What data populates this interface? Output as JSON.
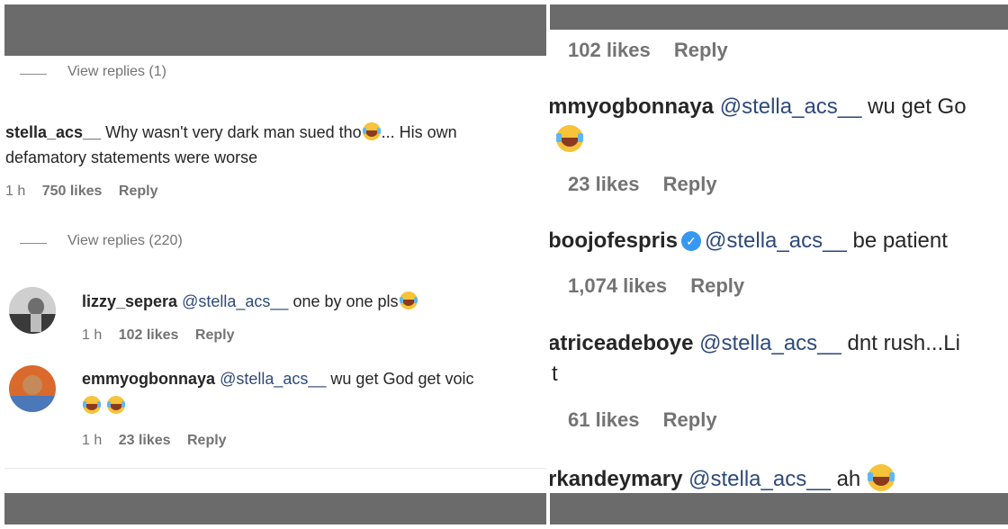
{
  "left": {
    "view_replies_1": "View replies (1)",
    "main_comment": {
      "username": "stella_acs__",
      "text_part1": "Why wasn't very dark man sued tho",
      "text_part2": "... His own",
      "text_line2": "defamatory statements were worse",
      "time": "1 h",
      "likes": "750 likes",
      "reply": "Reply"
    },
    "view_replies_2": "View replies (220)",
    "replies": [
      {
        "username": "lizzy_sepera",
        "mention": "@stella_acs__",
        "text": "one by one pls",
        "time": "1 h",
        "likes": "102 likes",
        "reply": "Reply"
      },
      {
        "username": "emmyogbonnaya",
        "mention": "@stella_acs__",
        "text": "wu get God get voic",
        "time": "1 h",
        "likes": "23 likes",
        "reply": "Reply"
      }
    ]
  },
  "right": {
    "top_likes": "102 likes",
    "top_reply": "Reply",
    "comments": [
      {
        "username": "mmyogbonnaya",
        "mention": "@stella_acs__",
        "text": "wu get Go",
        "likes": "23 likes",
        "reply": "Reply"
      },
      {
        "username": "boojofespris",
        "mention": "@stella_acs__",
        "text": "be patient",
        "likes": "1,074 likes",
        "reply": "Reply",
        "verified_glyph": "✓"
      },
      {
        "username": "atriceadeboye",
        "mention": "@stella_acs__",
        "text": "dnt rush...Li",
        "overflow_char": "t",
        "likes": "61 likes",
        "reply": "Reply"
      },
      {
        "username": "rkandeymary",
        "mention": "@stella_acs__",
        "text": "ah"
      }
    ]
  },
  "colors": {
    "bar": "#6b6b6b",
    "mention": "#2e4a7a",
    "meta": "#737373",
    "text": "#262626"
  }
}
